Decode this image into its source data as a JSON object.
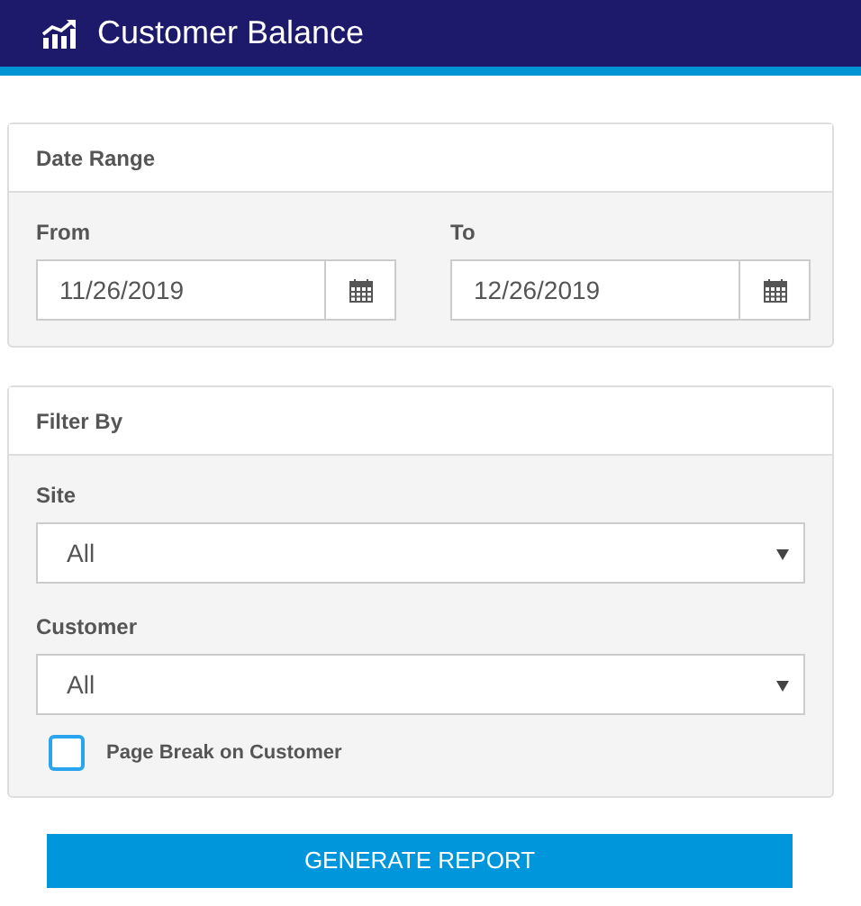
{
  "header": {
    "title": "Customer Balance"
  },
  "date_range": {
    "title": "Date Range",
    "fields": [
      {
        "label": "From",
        "value": "11/26/2019"
      },
      {
        "label": "To",
        "value": "12/26/2019"
      }
    ]
  },
  "filter_by": {
    "title": "Filter By",
    "selects": [
      {
        "label": "Site",
        "value": "All"
      },
      {
        "label": "Customer",
        "value": "All"
      }
    ],
    "checkbox": {
      "label": "Page Break on Customer",
      "checked": false
    }
  },
  "button": {
    "label": "GENERATE REPORT"
  }
}
